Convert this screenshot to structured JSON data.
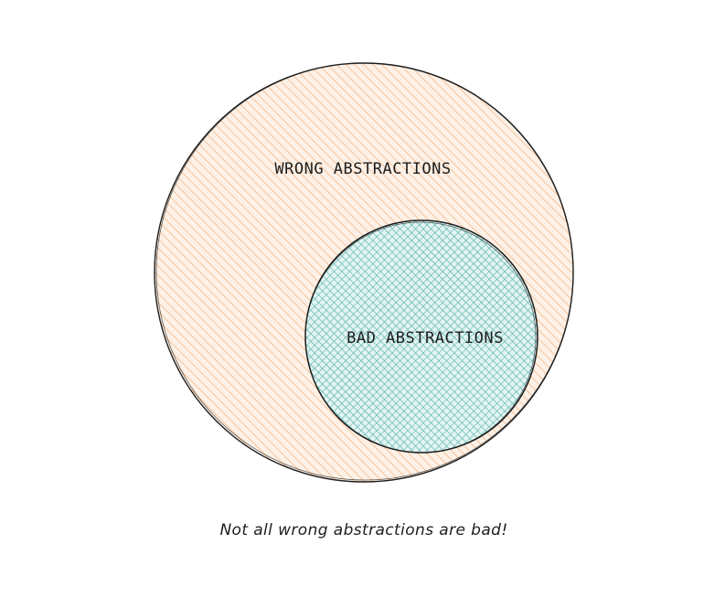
{
  "diagram": {
    "outer_set": {
      "label": "WRONG ABSTRACTIONS",
      "fill_color": "#f2b88a",
      "stroke_color": "#1e1e1e"
    },
    "inner_set": {
      "label": "BAD ABSTRACTIONS",
      "fill_color": "#5fb8b0",
      "stroke_color": "#1e1e1e"
    },
    "caption": "Not all wrong abstractions are bad!"
  }
}
